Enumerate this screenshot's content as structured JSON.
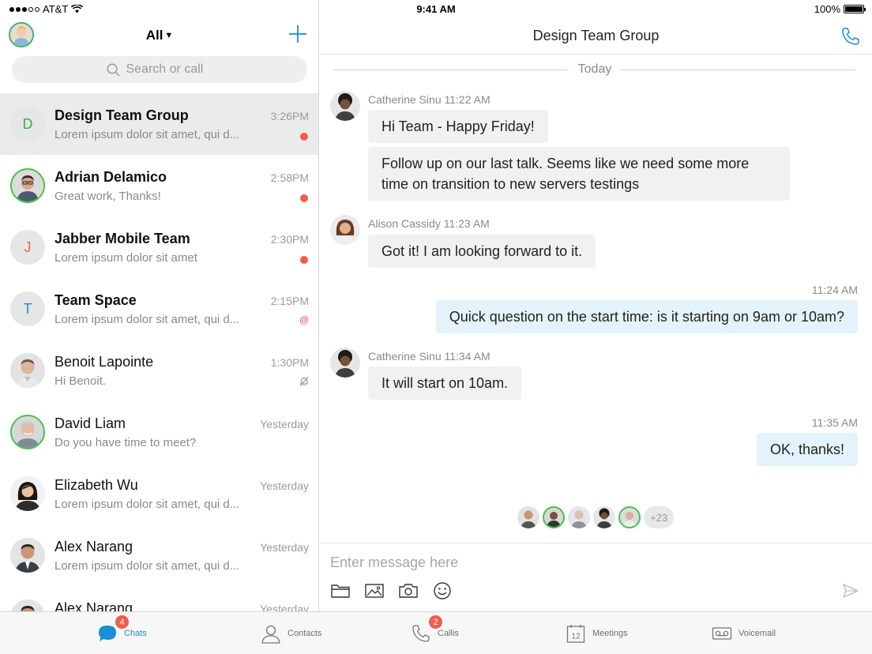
{
  "status_bar": {
    "carrier": "AT&T",
    "time": "9:41 AM",
    "battery": "100%"
  },
  "left": {
    "filter_label": "All",
    "search_placeholder": "Search or call",
    "chats": [
      {
        "name": "Design Team Group",
        "preview": "Lorem ipsum dolor sit amet, qui d...",
        "time": "3:26PM",
        "initial": "D",
        "initial_color": "#2fb34a",
        "bold": true,
        "indicator": "unread"
      },
      {
        "name": "Adrian Delamico",
        "preview": "Great work, Thanks!",
        "time": "2:58PM",
        "bold": true,
        "indicator": "unread"
      },
      {
        "name": "Jabber Mobile Team",
        "preview": "Lorem ipsum dolor sit amet",
        "time": "2:30PM",
        "initial": "J",
        "initial_color": "#f06a35",
        "bold": true,
        "indicator": "unread"
      },
      {
        "name": "Team Space",
        "preview": "Lorem ipsum dolor sit amet, qui d...",
        "time": "2:15PM",
        "initial": "T",
        "initial_color": "#1a8fd6",
        "bold": true,
        "indicator": "mention"
      },
      {
        "name": "Benoit Lapointe",
        "preview": "Hi Benoit.",
        "time": "1:30PM",
        "bold": false,
        "indicator": "muted"
      },
      {
        "name": "David Liam",
        "preview": "Do you have time to meet?",
        "time": "Yesterday",
        "bold": false,
        "indicator": "none"
      },
      {
        "name": "Elizabeth Wu",
        "preview": "Lorem ipsum dolor sit amet, qui d...",
        "time": "Yesterday",
        "bold": false,
        "indicator": "none"
      },
      {
        "name": "Alex Narang",
        "preview": "Lorem ipsum dolor sit amet, qui d...",
        "time": "Yesterday",
        "bold": false,
        "indicator": "none"
      },
      {
        "name": "Alex Narang",
        "preview": "",
        "time": "Yesterday",
        "bold": false,
        "indicator": "none"
      }
    ]
  },
  "conversation": {
    "title": "Design Team Group",
    "day_separator": "Today",
    "messages": [
      {
        "sender_meta": "Catherine Sinu 11:22 AM",
        "bubble1": "Hi Team - Happy Friday!",
        "bubble2_line1": "Follow up on our last talk. Seems like we need some more",
        "bubble2_line2": "time on transition to new servers testings"
      },
      {
        "sender_meta": "Alison Cassidy 11:23 AM",
        "bubble": "Got it! I am looking forward to it."
      },
      {
        "time": "11:24 AM",
        "bubble": "Quick question on the start time: is it starting on 9am or 10am?"
      },
      {
        "sender_meta": "Catherine Sinu  11:34 AM",
        "bubble": "It will start on 10am."
      },
      {
        "time": "11:35 AM",
        "bubble": "OK, thanks!"
      }
    ],
    "readers_more": "+23",
    "composer_placeholder": "Enter message here"
  },
  "tabs": [
    {
      "label": "Chats",
      "badge": "4",
      "active": true
    },
    {
      "label": "Contacts"
    },
    {
      "label": "Callis",
      "badge": "2"
    },
    {
      "label": "Meetings",
      "icon_text": "12"
    },
    {
      "label": "Voicemail"
    }
  ],
  "colors": {
    "accent": "#1a8fd6",
    "unread": "#f05d4a",
    "presence": "#41c341",
    "bubble_in": "#f1f1f1",
    "bubble_out": "#e4f3fb"
  }
}
